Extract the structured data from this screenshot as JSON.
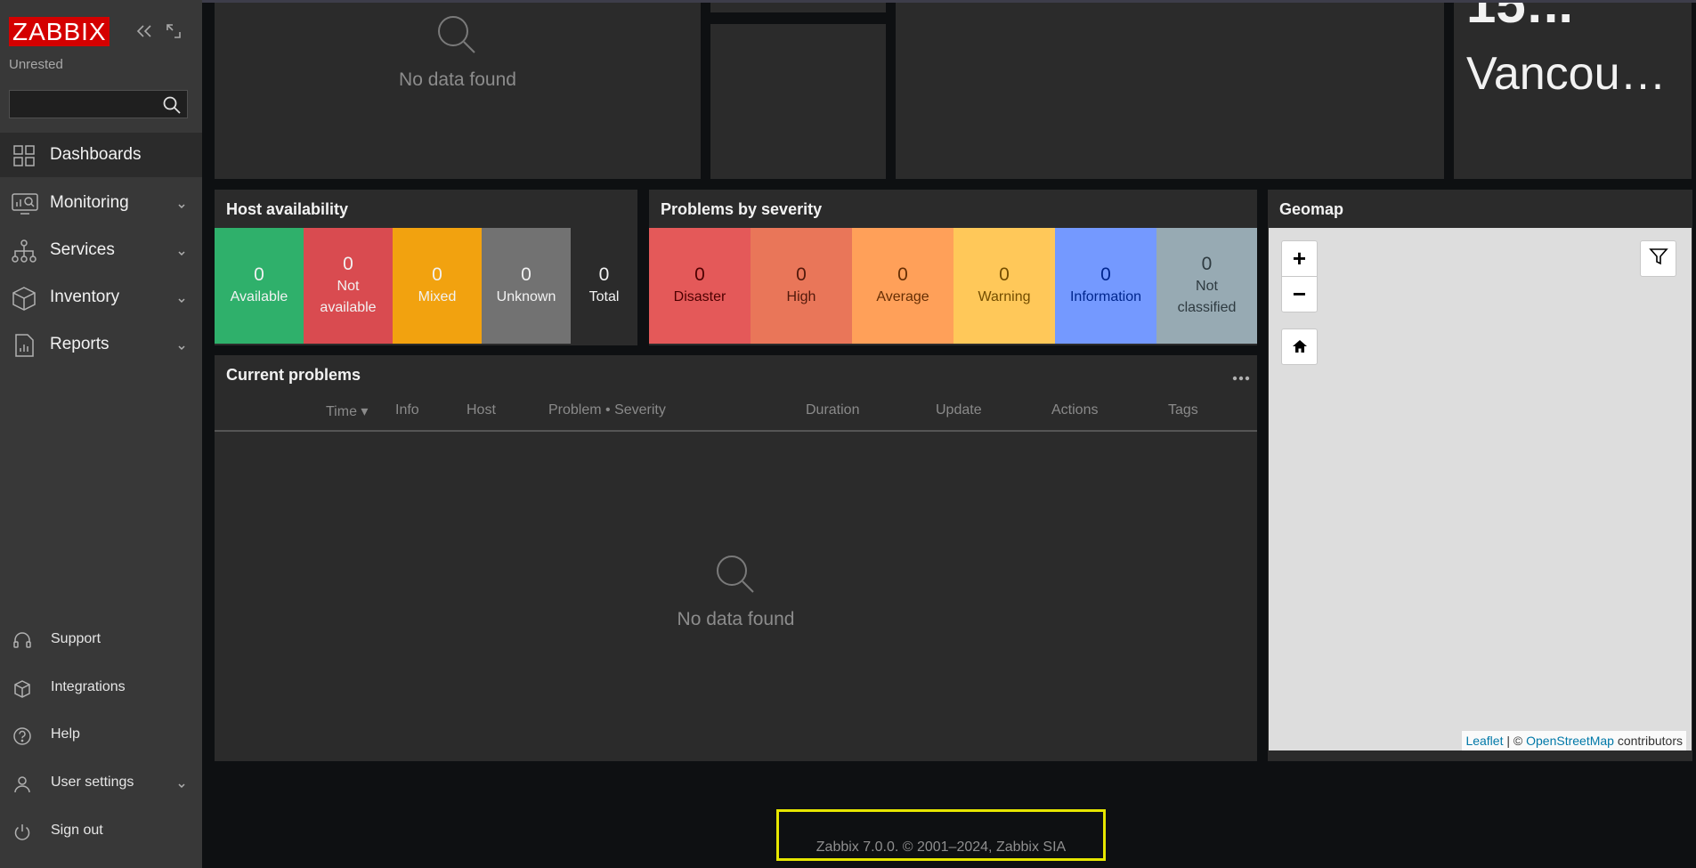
{
  "sidebar": {
    "logo_text": "ZABBIX",
    "server_name": "Unrested",
    "search_placeholder": "",
    "nav": [
      {
        "label": "Dashboards",
        "icon": "dashboards-icon",
        "active": true
      },
      {
        "label": "Monitoring",
        "icon": "monitoring-icon"
      },
      {
        "label": "Services",
        "icon": "services-icon"
      },
      {
        "label": "Inventory",
        "icon": "inventory-icon"
      },
      {
        "label": "Reports",
        "icon": "reports-icon"
      }
    ],
    "bottom": [
      {
        "label": "Support",
        "icon": "headset-icon"
      },
      {
        "label": "Integrations",
        "icon": "integrations-icon"
      },
      {
        "label": "Help",
        "icon": "help-icon"
      },
      {
        "label": "User settings",
        "icon": "user-icon"
      },
      {
        "label": "Sign out",
        "icon": "power-icon"
      }
    ]
  },
  "top_row": {
    "no_data": "No data found",
    "clock_time": "15:..",
    "clock_city": "Vancou…"
  },
  "host_availability": {
    "title": "Host availability",
    "cells": [
      {
        "value": "0",
        "label": "Available",
        "color": "#2fb06b"
      },
      {
        "value": "0",
        "label": "Not available",
        "color": "#d94b50"
      },
      {
        "value": "0",
        "label": "Mixed",
        "color": "#f2a20f"
      },
      {
        "value": "0",
        "label": "Unknown",
        "color": "#727272"
      },
      {
        "value": "0",
        "label": "Total",
        "color": "#2b2b2b"
      }
    ]
  },
  "problems_by_severity": {
    "title": "Problems by severity",
    "cells": [
      {
        "value": "0",
        "label": "Disaster",
        "color": "#e45959"
      },
      {
        "value": "0",
        "label": "High",
        "color": "#e97659"
      },
      {
        "value": "0",
        "label": "Average",
        "color": "#ffa059"
      },
      {
        "value": "0",
        "label": "Warning",
        "color": "#ffc859"
      },
      {
        "value": "0",
        "label": "Information",
        "color": "#7499ff"
      },
      {
        "value": "0",
        "label": "Not classified",
        "color": "#97aab3"
      }
    ]
  },
  "current_problems": {
    "title": "Current problems",
    "columns": [
      "Time ▾",
      "Info",
      "Host",
      "Problem • Severity",
      "Duration",
      "Update",
      "Actions",
      "Tags"
    ],
    "no_data": "No data found"
  },
  "geomap": {
    "title": "Geomap",
    "zoom_in": "+",
    "zoom_out": "−",
    "attribution_leaflet": "Leaflet",
    "attribution_sep": " | © ",
    "attribution_osm": "OpenStreetMap",
    "attribution_tail": " contributors"
  },
  "footer": {
    "text": "Zabbix 7.0.0. © 2001–2024, Zabbix SIA"
  }
}
